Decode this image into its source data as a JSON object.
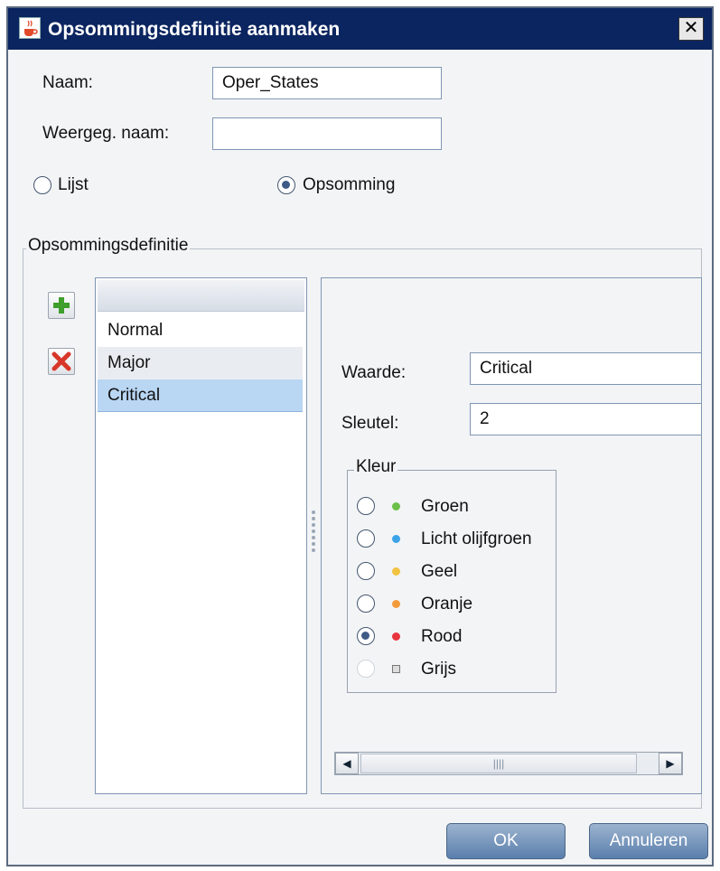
{
  "window": {
    "title": "Opsommingsdefinitie aanmaken",
    "close_icon": "close-icon",
    "app_icon": "java-cup-icon"
  },
  "form": {
    "name_label": "Naam:",
    "name_value": "Oper_States",
    "display_name_label": "Weergeg. naam:",
    "display_name_value": "",
    "type_options": [
      {
        "label": "Lijst",
        "selected": false
      },
      {
        "label": "Opsomming",
        "selected": true
      }
    ]
  },
  "definition": {
    "group_title": "Opsommingsdefinitie",
    "add_icon": "plus-icon",
    "delete_icon": "delete-x-icon",
    "items": [
      "Normal",
      "Major",
      "Critical"
    ],
    "selected_item": "Critical",
    "value_label": "Waarde:",
    "value": "Critical",
    "key_label": "Sleutel:",
    "key": "2",
    "color_group_title": "Kleur",
    "colors": [
      {
        "label": "Groen",
        "dot": "#6cc04a",
        "selected": false,
        "disabled": false
      },
      {
        "label": "Licht olijfgroen",
        "dot": "#3da3e8",
        "selected": false,
        "disabled": false
      },
      {
        "label": "Geel",
        "dot": "#f2c341",
        "selected": false,
        "disabled": false
      },
      {
        "label": "Oranje",
        "dot": "#f39a3b",
        "selected": false,
        "disabled": false
      },
      {
        "label": "Rood",
        "dot": "#e8353e",
        "selected": true,
        "disabled": false
      },
      {
        "label": "Grijs",
        "dot": "#9a9a9a",
        "selected": false,
        "disabled": true
      }
    ]
  },
  "buttons": {
    "ok": "OK",
    "cancel": "Annuleren"
  }
}
